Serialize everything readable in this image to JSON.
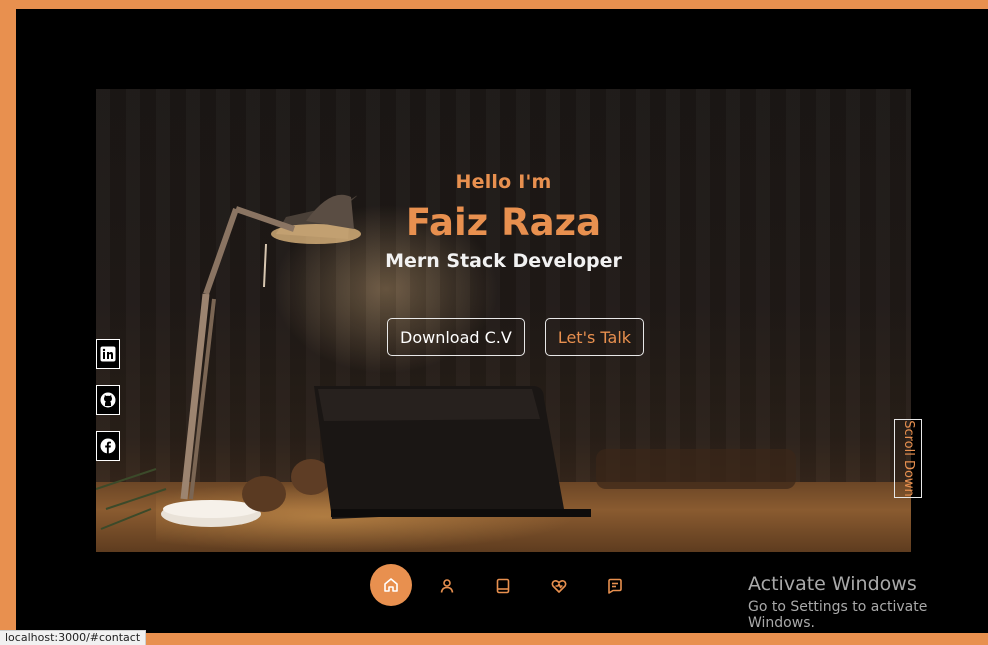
{
  "hero": {
    "greeting": "Hello I'm",
    "name": "Faiz Raza",
    "role": "Mern Stack Developer",
    "download_label": "Download C.V",
    "talk_label": "Let's Talk",
    "scroll_label": "Scroll Down"
  },
  "socials": [
    {
      "icon": "linkedin-icon"
    },
    {
      "icon": "github-icon"
    },
    {
      "icon": "facebook-icon"
    }
  ],
  "nav": {
    "items": [
      {
        "icon": "home-icon",
        "active": true
      },
      {
        "icon": "user-icon",
        "active": false
      },
      {
        "icon": "book-icon",
        "active": false
      },
      {
        "icon": "heart-icon",
        "active": false
      },
      {
        "icon": "message-icon",
        "active": false
      }
    ]
  },
  "windows_watermark": {
    "title": "Activate Windows",
    "subtitle": "Go to Settings to activate Windows."
  },
  "status_bar": {
    "url": "localhost:3000/#contact"
  },
  "colors": {
    "accent": "#e8904f",
    "background": "#000000",
    "text": "#ffffff"
  }
}
